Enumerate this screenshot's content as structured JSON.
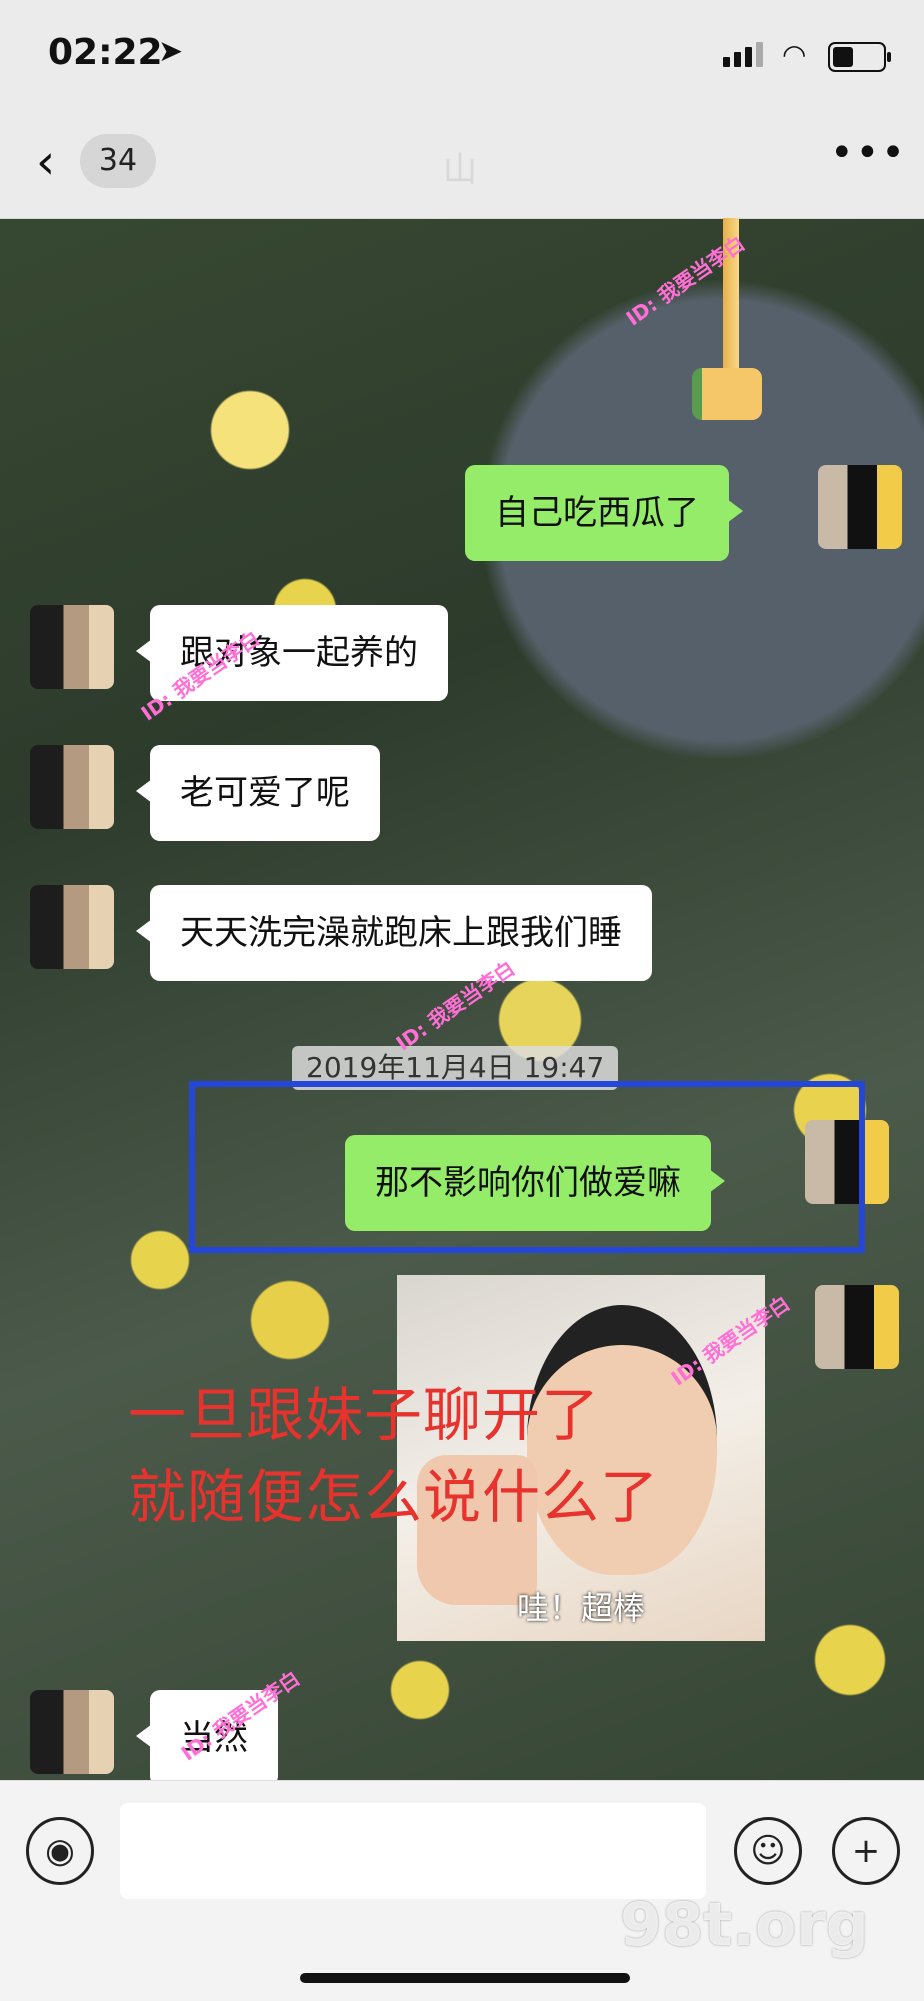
{
  "status_bar": {
    "time": "02:22",
    "location_icon": "location-arrow-icon",
    "signal_icon": "cellular-signal-icon",
    "wifi_icon": "wifi-icon",
    "battery_icon": "battery-icon",
    "battery_level": 0.35
  },
  "nav": {
    "back_icon": "chevron-left-icon",
    "unread_count": "34",
    "title": "山",
    "more_label": "•••"
  },
  "messages": [
    {
      "side": "right",
      "text": "自己吃西瓜了"
    },
    {
      "side": "left",
      "text": "跟对象一起养的"
    },
    {
      "side": "left",
      "text": "老可爱了呢"
    },
    {
      "side": "left",
      "text": "天天洗完澡就跑床上跟我们睡"
    },
    {
      "side": "right",
      "text": "那不影响你们做爱嘛"
    },
    {
      "side": "left",
      "text": "当然"
    }
  ],
  "timestamp": "2019年11月4日 19:47",
  "sticker": {
    "caption": "哇！超棒"
  },
  "overlay_text": {
    "line1": "一旦跟妹子聊开了",
    "line2": "就随便怎么说什么了"
  },
  "input_bar": {
    "voice_icon": "voice-icon",
    "emoji_icon": "smiley-icon",
    "plus_icon": "plus-icon",
    "voice_symbol": "◉",
    "emoji_symbol": "☺",
    "plus_symbol": "+"
  },
  "watermarks": {
    "site": "98t.org",
    "id_tag": "ID: 我要当李白"
  },
  "colors": {
    "sent_bubble": "#95ec69",
    "received_bubble": "#ffffff",
    "highlight_box": "#2446d9",
    "overlay_text": "#e8322d"
  }
}
